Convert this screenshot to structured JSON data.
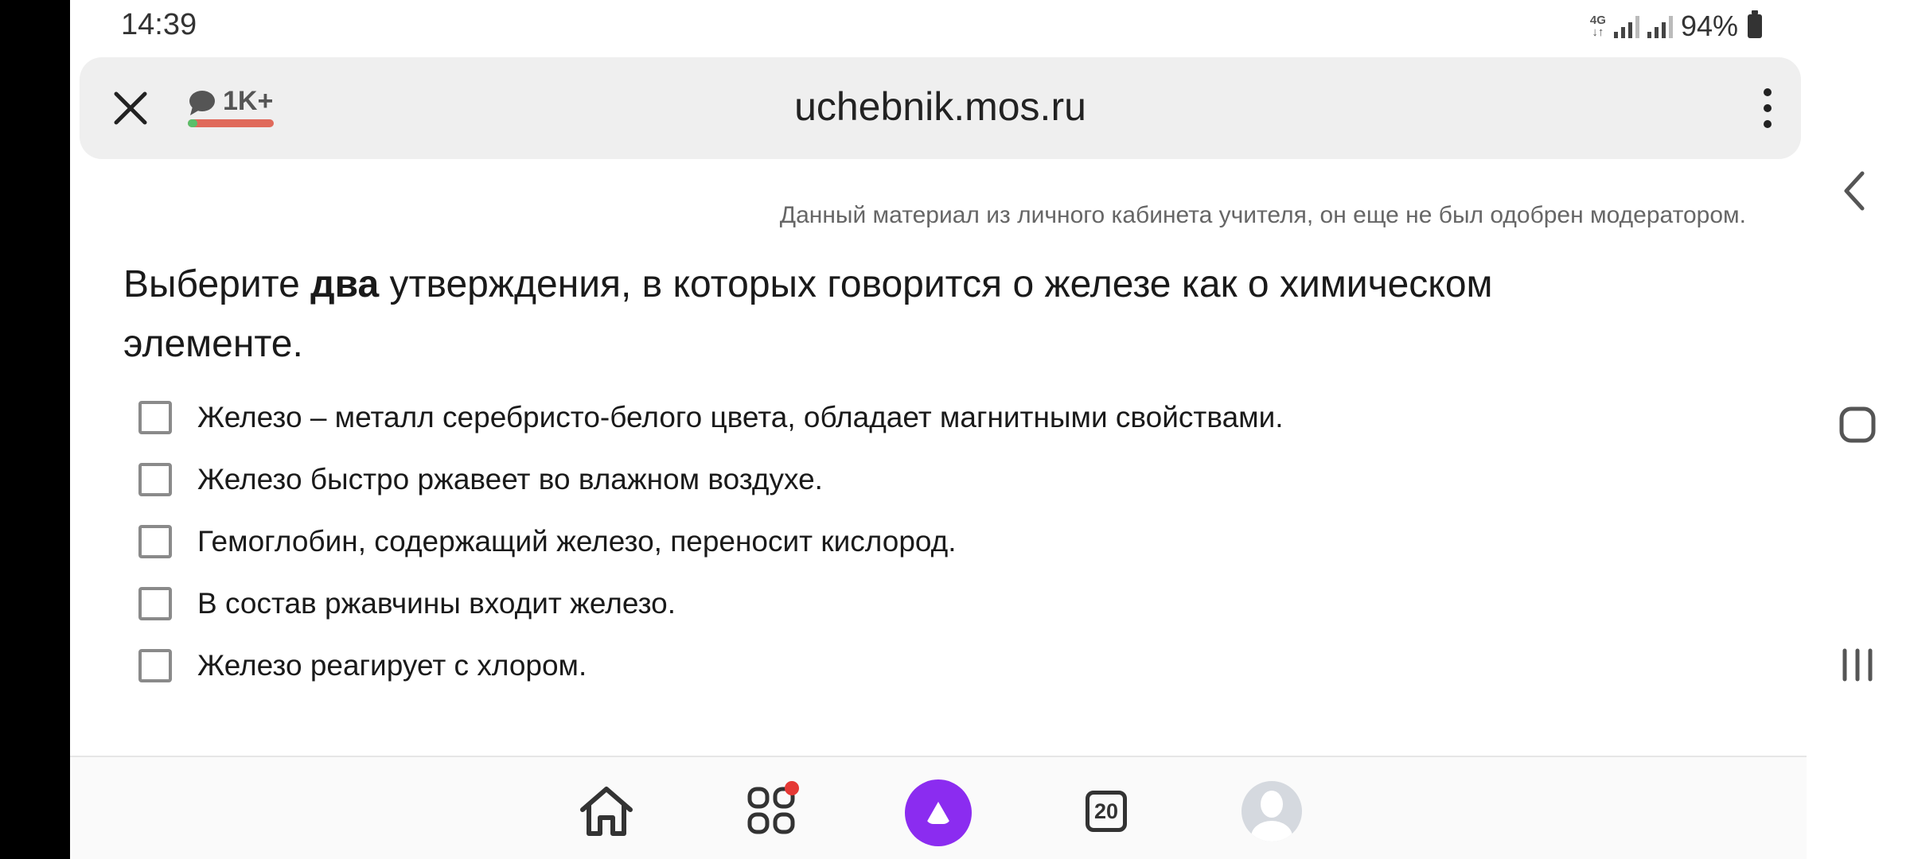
{
  "status_bar": {
    "time": "14:39",
    "network": "4G",
    "battery_percent": "94%"
  },
  "url_bar": {
    "comments_count": "1K+",
    "url": "uchebnik.mos.ru"
  },
  "content": {
    "notice": "Данный материал из личного кабинета учителя, он еще не был одобрен модератором.",
    "question": {
      "prefix": "Выберите ",
      "emphasis": "два",
      "suffix": " утверждения, в которых говорится о железе как о химическом элементе."
    },
    "options": [
      {
        "label": "Железо – металл серебристо-белого цвета, обладает магнитными свойствами.",
        "checked": false
      },
      {
        "label": "Железо быстро ржавеет во влажном воздухе.",
        "checked": false
      },
      {
        "label": "Гемоглобин, содержащий железо, переносит кислород.",
        "checked": false
      },
      {
        "label": "В состав ржавчины входит железо.",
        "checked": false
      },
      {
        "label": "Железо реагирует с хлором.",
        "checked": false
      }
    ]
  },
  "bottom_nav": {
    "tabs_count": "20",
    "items": [
      "home-icon",
      "services-icon",
      "alice-icon",
      "tabs-icon",
      "profile-avatar"
    ]
  },
  "colors": {
    "alice": "#8b2cf0",
    "notification_dot": "#e53935",
    "comments_bar": "#e06a5b"
  }
}
